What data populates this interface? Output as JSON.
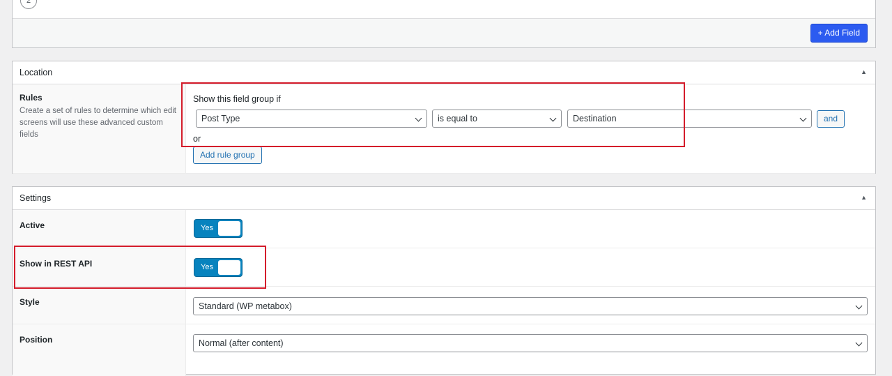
{
  "fields_panel": {
    "field_number": "2",
    "add_field_label": "+ Add Field"
  },
  "location": {
    "title": "Location",
    "rules_label": "Rules",
    "rules_description": "Create a set of rules to determine which edit screens will use these advanced custom fields",
    "show_if": "Show this field group if",
    "param_select": "Post Type",
    "operator_select": "is equal to",
    "value_select": "Destination",
    "and_label": "and",
    "or_label": "or",
    "add_rule_group_label": "Add rule group"
  },
  "settings": {
    "title": "Settings",
    "active_label": "Active",
    "active_value": "Yes",
    "rest_api_label": "Show in REST API",
    "rest_api_value": "Yes",
    "style_label": "Style",
    "style_value": "Standard (WP metabox)",
    "position_label": "Position",
    "position_value": "Normal (after content)"
  },
  "colors": {
    "primary_button": "#2c5bf0",
    "toggle_on": "#0783be",
    "highlight_box": "#d41c2b"
  }
}
